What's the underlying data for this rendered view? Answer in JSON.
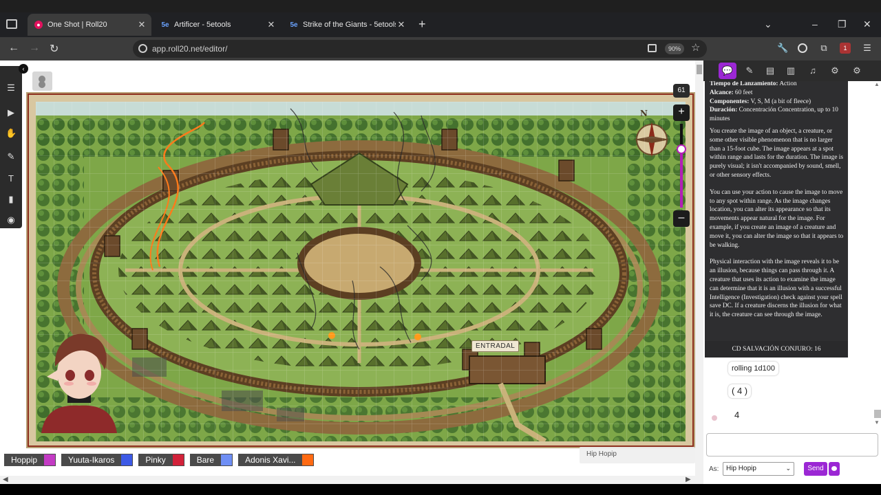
{
  "browser": {
    "tabs": [
      {
        "title": "One Shot | Roll20",
        "favicon": "roll20-icon",
        "active": true
      },
      {
        "title": "Artificer - 5etools",
        "favicon": "5etools-icon",
        "active": false
      },
      {
        "title": "Strike of the Giants - 5etools",
        "favicon": "5etools-icon",
        "active": false
      }
    ],
    "url": "app.roll20.net/editor/",
    "zoom": "90%",
    "extension_badge": "1"
  },
  "canvas": {
    "zoom_level": "61",
    "zoom_fraction": 0.7,
    "map_label": "ENTRADAL",
    "compass_letter": "N"
  },
  "players": [
    {
      "name": "Hoppip",
      "color": "#c33bc4"
    },
    {
      "name": "Yuuta-Ikaros",
      "color": "#3d5ae6"
    },
    {
      "name": "Pinky",
      "color": "#d2223a"
    },
    {
      "name": "Bare",
      "color": "#6f8ff5"
    },
    {
      "name": "Adonis Xavi...",
      "color": "#ff6a13"
    }
  ],
  "floating_player": "Hip Hopip",
  "spell": {
    "casting_time_label": "Tiempo de Lanzamiento:",
    "casting_time": "Action",
    "range_label": "Alcance:",
    "range": "60 feet",
    "components_label": "Componentes:",
    "components": "V, S, M (a bit of fleece)",
    "duration_label": "Duración:",
    "duration": "Concentración Concentration, up to 10 minutes",
    "p1": "You create the image of an object, a creature, or some other visible phenomenon that is no larger than a 15-foot cube. The image appears at a spot within range and lasts for the duration. The image is purely visual; it isn't accompanied by sound, smell, or other sensory effects.",
    "p2": "You can use your action to cause the image to move to any spot within range. As the image changes location, you can alter its appearance so that its movements appear natural for the image. For example, if you create an image of a creature and move it, you can alter the image so that it appears to be walking.",
    "p3": "Physical interaction with the image reveals it to be an illusion, because things can pass through it. A creature that uses its action to examine the image can determine that it is an illusion with a successful Intelligence (Investigation) check against your spell save DC. If a creature discerns the illusion for what it is, the creature can see through the image.",
    "save_dc": "CD SALVACIÓN CONJURO: 16"
  },
  "chat": {
    "roll_text": "rolling 1d100",
    "roll_detail": "( 4 )",
    "roll_result": "4",
    "as_label": "As:",
    "as_value": "Hip Hopip",
    "send_label": "Send"
  }
}
